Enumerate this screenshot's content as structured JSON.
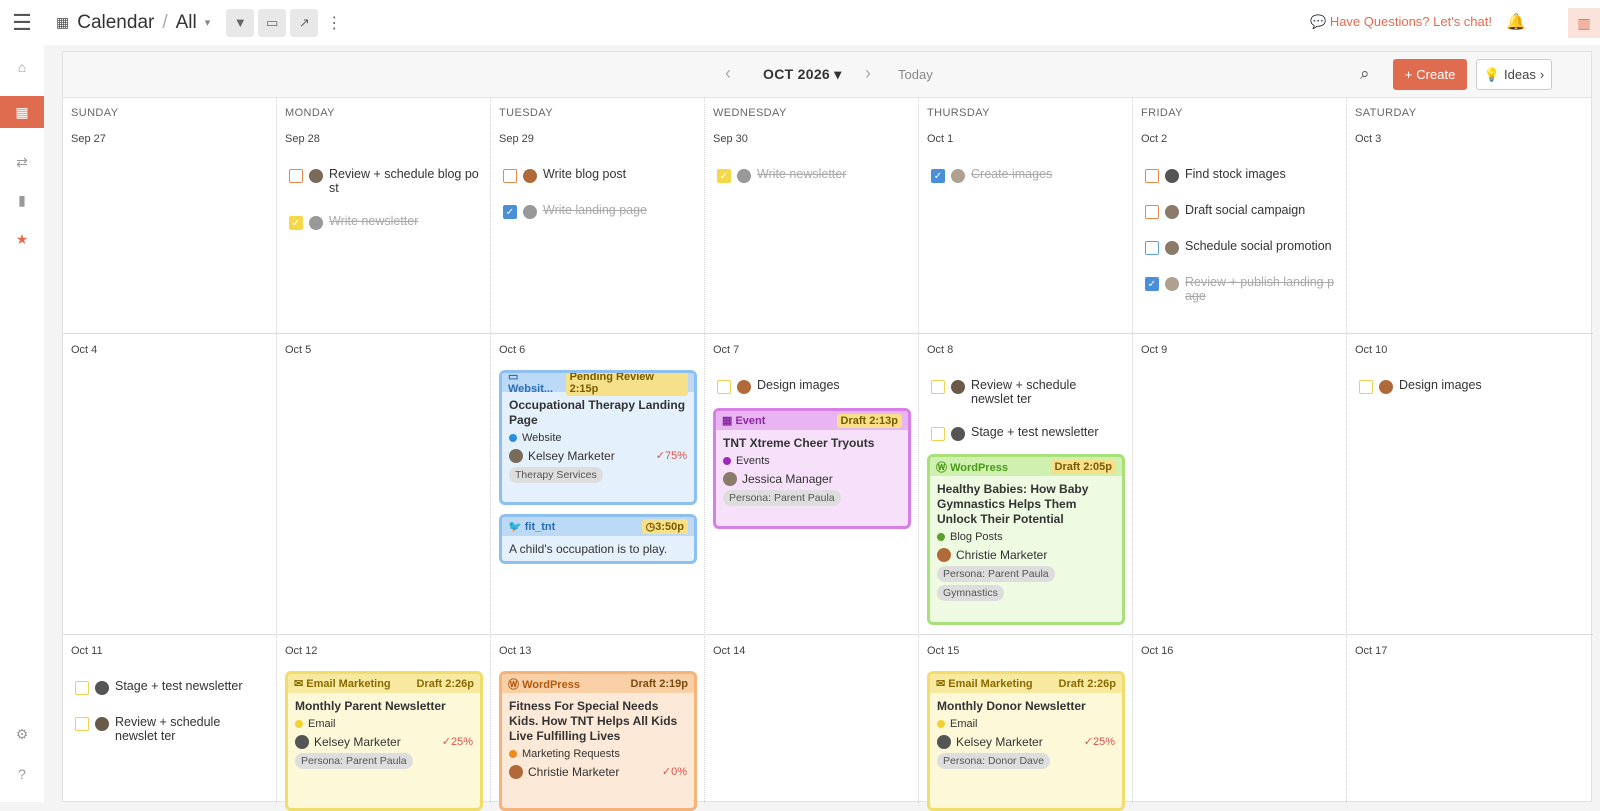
{
  "header": {
    "title": "Calendar",
    "view": "All",
    "chat": "Have Questions? Let's chat!"
  },
  "toolbar": {
    "month": "OCT 2026",
    "today": "Today",
    "create": "Create",
    "ideas": "Ideas"
  },
  "days": [
    "SUNDAY",
    "MONDAY",
    "TUESDAY",
    "WEDNESDAY",
    "THURSDAY",
    "FRIDAY",
    "SATURDAY"
  ],
  "dates": [
    [
      "Sep 27",
      "Sep 28",
      "Sep 29",
      "Sep 30",
      "Oct 1",
      "Oct 2",
      "Oct 3"
    ],
    [
      "Oct 4",
      "Oct 5",
      "Oct 6",
      "Oct 7",
      "Oct 8",
      "Oct 9",
      "Oct 10"
    ],
    [
      "Oct 11",
      "Oct 12",
      "Oct 13",
      "Oct 14",
      "Oct 15",
      "Oct 16",
      "Oct 17"
    ]
  ],
  "tasks": {
    "w1_mon_1": "Review + schedule blog po st",
    "w1_mon_2": "Write newsletter",
    "w1_tue_1": "Write blog post",
    "w1_tue_2": "Write landing page",
    "w1_wed_1": "Write newsletter",
    "w1_thu_1": "Create images",
    "w1_fri_1": "Find stock images",
    "w1_fri_2": "Draft social campaign",
    "w1_fri_3": "Schedule social promotion",
    "w1_fri_4": "Review + publish landing p age",
    "w2_wed_1": "Design images",
    "w2_thu_1": "Review + schedule newslet ter",
    "w2_thu_2": "Stage + test newsletter",
    "w2_sat_1": "Design images",
    "w3_sun_1": "Stage + test newsletter",
    "w3_sun_2": "Review + schedule newslet ter"
  },
  "cards": {
    "otl": {
      "type": "Websit...",
      "status": "Pending Review",
      "time": "2:15p",
      "title": "Occupational Therapy Landing Page",
      "category": "Website",
      "person": "Kelsey Marketer",
      "pct": "75%",
      "tags": [
        "Therapy Services"
      ]
    },
    "tw": {
      "account": "fit_tnt",
      "time": "3:50p",
      "text": "A child's occupation is to play."
    },
    "ev": {
      "type": "Event",
      "status": "Draft",
      "time": "2:13p",
      "title": "TNT Xtreme Cheer Tryouts",
      "category": "Events",
      "person": "Jessica Manager",
      "tags": [
        "Persona: Parent Paula"
      ]
    },
    "wp1": {
      "type": "WordPress",
      "status": "Draft",
      "time": "2:05p",
      "title": "Healthy Babies: How Baby Gymnastics Helps Them Unlock Their Potential",
      "category": "Blog Posts",
      "person": "Christie Marketer",
      "tags": [
        "Persona: Parent Paula",
        "Gymnastics"
      ]
    },
    "em1": {
      "type": "Email Marketing",
      "status": "Draft",
      "time": "2:26p",
      "title": "Monthly Parent Newsletter",
      "category": "Email",
      "person": "Kelsey Marketer",
      "pct": "25%",
      "tags": [
        "Persona: Parent Paula"
      ]
    },
    "wp2": {
      "type": "WordPress",
      "status": "Draft",
      "time": "2:19p",
      "title": "Fitness For Special Needs Kids. How TNT Helps All Kids Live Fulfilling Lives",
      "category": "Marketing Requests",
      "person": "Christie Marketer",
      "pct": "0%"
    },
    "em2": {
      "type": "Email Marketing",
      "status": "Draft",
      "time": "2:26p",
      "title": "Monthly Donor Newsletter",
      "category": "Email",
      "person": "Kelsey Marketer",
      "pct": "25%",
      "tags": [
        "Persona: Donor Dave"
      ]
    }
  }
}
